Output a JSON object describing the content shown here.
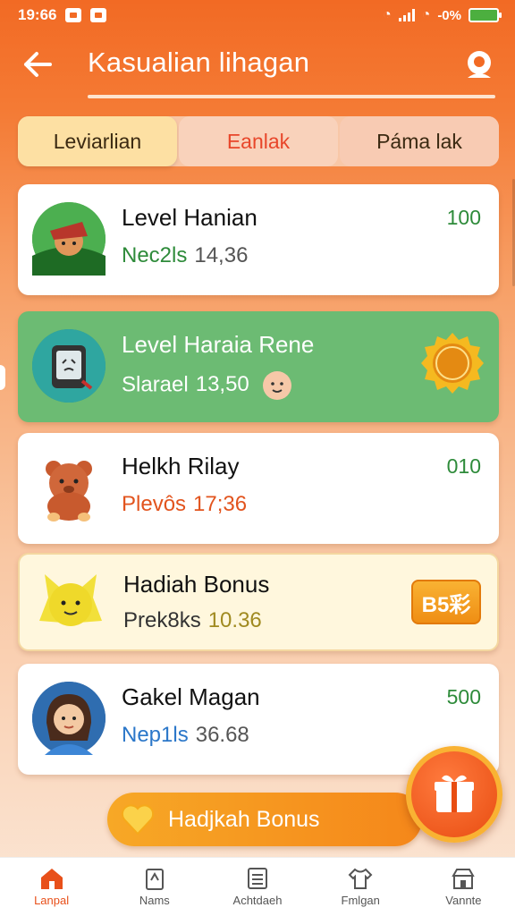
{
  "status_bar": {
    "time": "19:66",
    "battery": "-0%"
  },
  "app_bar": {
    "title": "Kasualian lihagan"
  },
  "tabs": [
    {
      "label": "Leviarlian"
    },
    {
      "label": "Eanlak"
    },
    {
      "label": "Páma lak"
    }
  ],
  "cards": [
    {
      "name": "Level Hanian",
      "sub_lead": "Nec2ls",
      "sub_num": "14,36",
      "points": "100"
    },
    {
      "name": "Level Haraia Rene",
      "sub_lead": "Slarael",
      "sub_num": "13,50",
      "points": ""
    },
    {
      "name": "Helkh Rilay",
      "sub_lead": "Plevôs",
      "sub_num": "17;36",
      "points": "010"
    },
    {
      "name": "Hadiah Bonus",
      "sub_lead": "Prek8ks",
      "sub_num": "10.36",
      "chip": "B5彩"
    },
    {
      "name": "Gakel Magan",
      "sub_lead": "Nep1ls",
      "sub_num": "36.68",
      "points": "500"
    }
  ],
  "bonus_button": {
    "label": "Hadjkah Bonus"
  },
  "bottom_nav": [
    {
      "label": "Lanpal"
    },
    {
      "label": "Nams"
    },
    {
      "label": "Achtdaeh"
    },
    {
      "label": "Fmlgan"
    },
    {
      "label": "Vannte"
    }
  ],
  "colors": {
    "primary": "#f26a24",
    "accent_green": "#6cbb73",
    "points_green": "#2e8b3a",
    "bonus_orange": "#f5871a"
  }
}
